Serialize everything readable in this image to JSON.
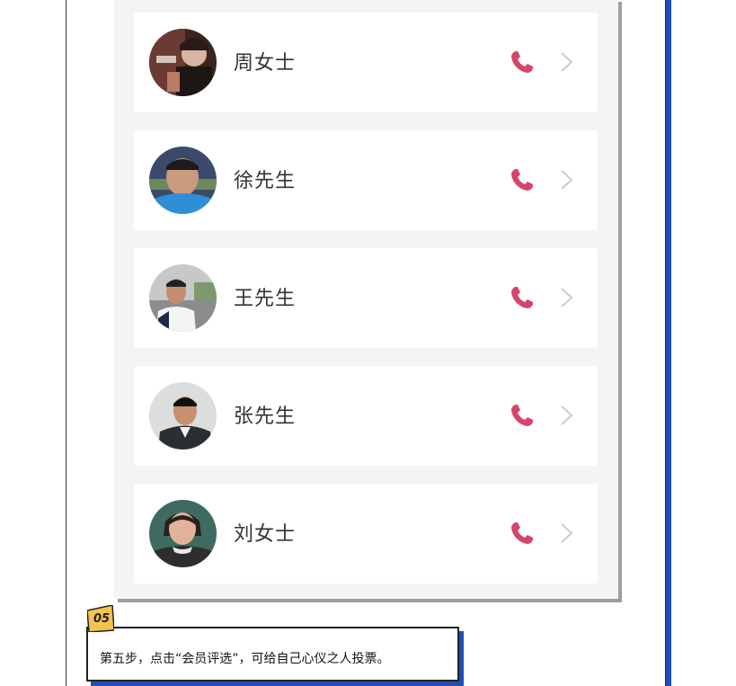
{
  "contacts": [
    {
      "name": "周女士",
      "avatar": "photo-woman-smoking"
    },
    {
      "name": "徐先生",
      "avatar": "photo-man-blue-shirt"
    },
    {
      "name": "王先生",
      "avatar": "photo-man-roadside"
    },
    {
      "name": "张先生",
      "avatar": "photo-man-jacket"
    },
    {
      "name": "刘女士",
      "avatar": "photo-woman-smiling"
    }
  ],
  "icons": {
    "call": "phone-icon",
    "open": "chevron-right-icon"
  },
  "step": {
    "number": "05",
    "caption": "第五步，点击“会员评选”，可给自己心仪之人投票。"
  },
  "colors": {
    "accent_blue": "#1f4fb4",
    "phone_red": "#d6456b",
    "badge_yellow": "#f3c34f",
    "chevron_gray": "#cccccc"
  }
}
